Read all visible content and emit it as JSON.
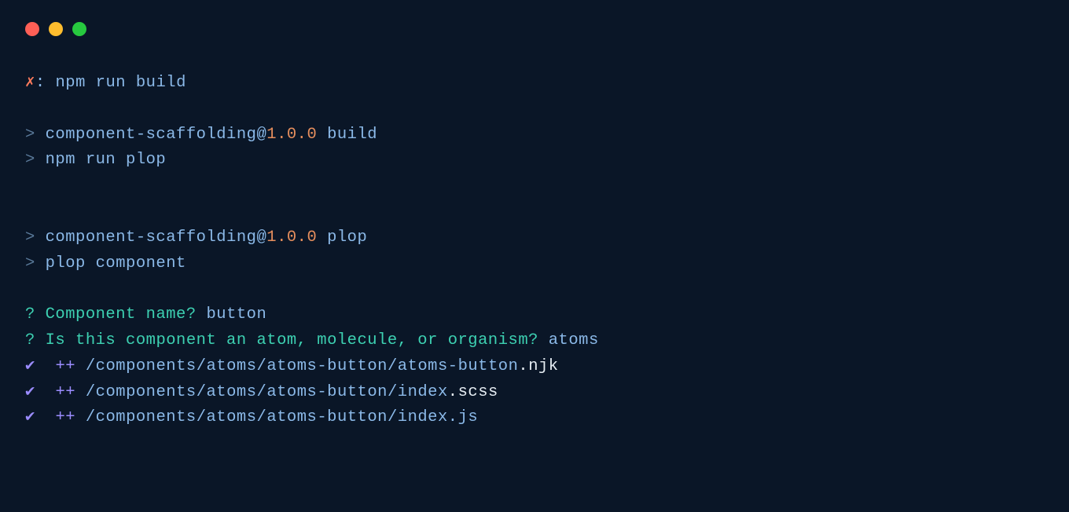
{
  "window_controls": [
    "close",
    "minimize",
    "zoom"
  ],
  "prompt": {
    "symbol": "✗",
    "sep": ":",
    "command": "npm run build"
  },
  "blocks": [
    {
      "header_parts": {
        "gt": "> ",
        "pkg": "component-scaffolding",
        "at": "@",
        "ver": "1.0.0",
        "script": " build"
      },
      "cmd_parts": {
        "gt": "> ",
        "cmd": "npm run plop"
      }
    },
    {
      "header_parts": {
        "gt": "> ",
        "pkg": "component-scaffolding",
        "at": "@",
        "ver": "1.0.0",
        "script": " plop"
      },
      "cmd_parts": {
        "gt": "> ",
        "cmd": "plop component"
      }
    }
  ],
  "prompts": [
    {
      "mark": "?",
      "question": "Component name?",
      "answer": "button"
    },
    {
      "mark": "?",
      "question": "Is this component an atom, molecule, or organism?",
      "answer": "atoms"
    }
  ],
  "added": [
    {
      "check": "✔",
      "plus": "++",
      "pre": "/components/",
      "mid1": "atoms",
      "sep1": "/",
      "file": "atoms-button",
      "sep2": "/",
      "tail1": "atoms-button",
      "dot": ".",
      "ext": "njk",
      "ext_class": "white"
    },
    {
      "check": "✔",
      "plus": "++",
      "pre": "/components/",
      "mid1": "atoms",
      "sep1": "/",
      "file": "atoms-button",
      "sep2": "/",
      "tail1": "index",
      "dot": ".",
      "ext": "scss",
      "ext_class": "white"
    },
    {
      "check": "✔",
      "plus": "++",
      "pre": "/components/",
      "mid1": "atoms",
      "sep1": "/",
      "file": "atoms-button",
      "sep2": "/",
      "tail1": "index",
      "dot": ".",
      "ext": "js",
      "ext_class": "blue"
    }
  ]
}
